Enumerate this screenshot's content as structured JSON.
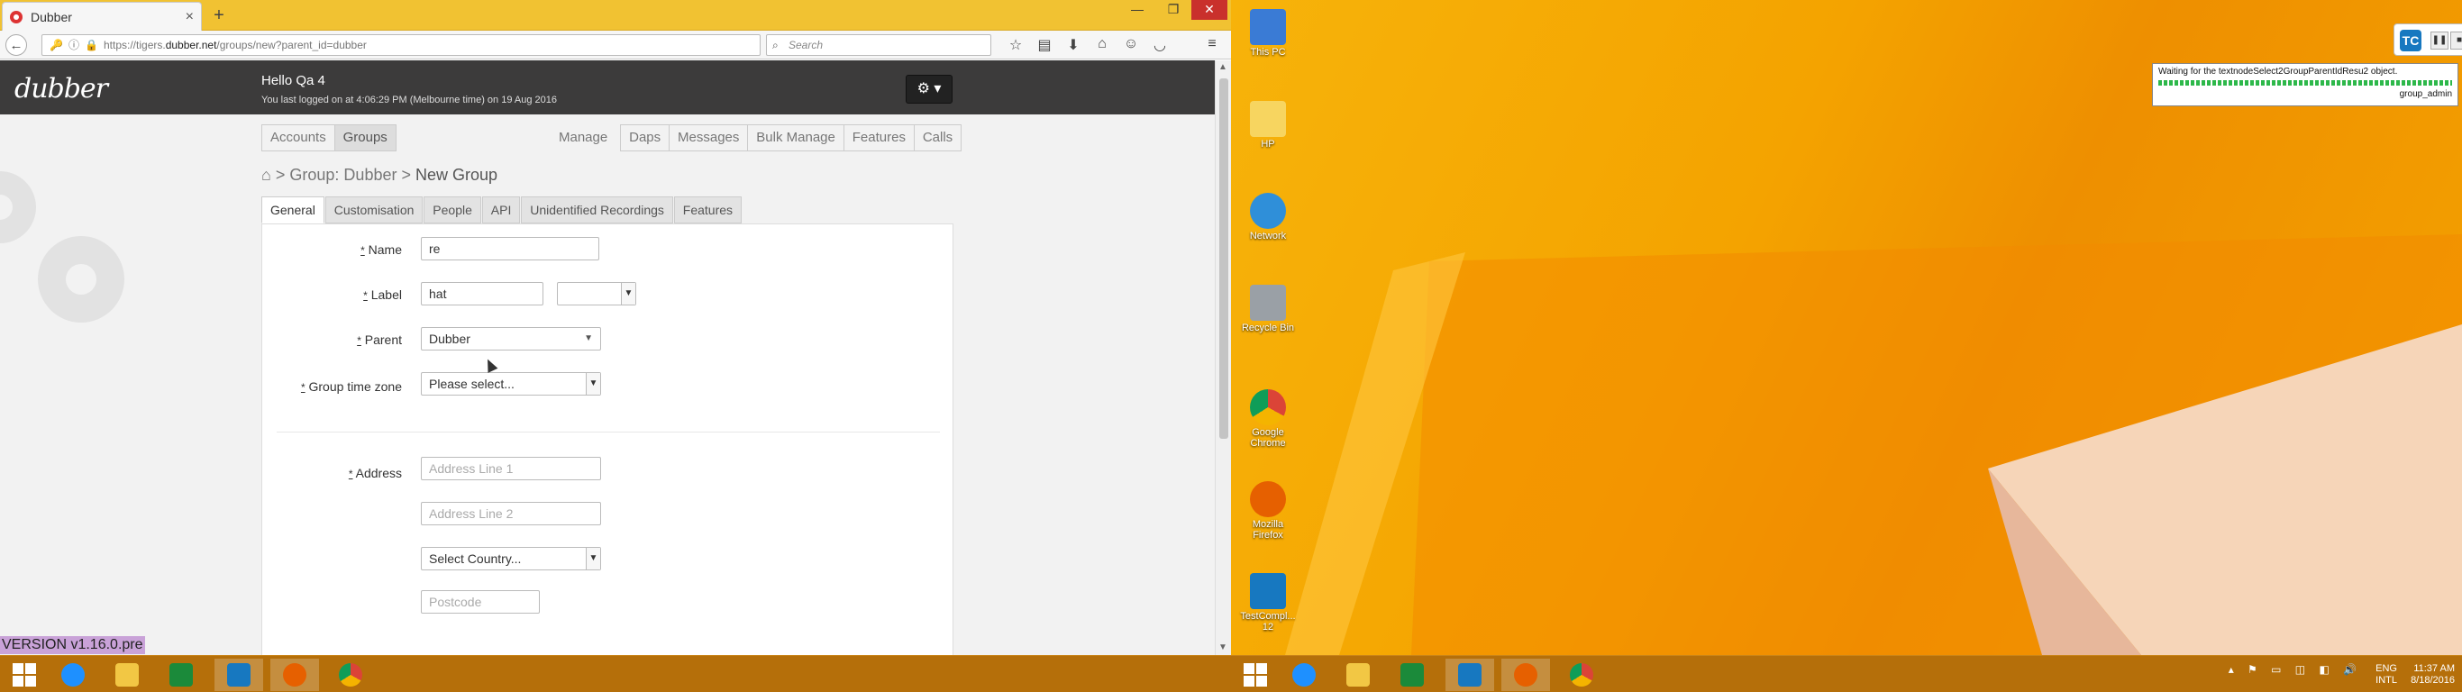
{
  "browser": {
    "tab_title": "Dubber",
    "tab_close": "×",
    "new_tab": "+",
    "url_prefix": "https://tigers.",
    "url_domain": "dubber.net",
    "url_path": "/groups/new?parent_id=dubber",
    "search_placeholder": "Search",
    "window_controls": {
      "minimize": "—",
      "restore": "❐",
      "close": "✕"
    }
  },
  "app": {
    "logo": "dubber",
    "greeting": "Hello Qa 4",
    "last_logon": "You last logged on at 4:06:29 PM (Melbourne time) on 19 Aug 2016",
    "settings_icon": "⚙ ▾",
    "primary_nav": [
      {
        "label": "Accounts",
        "active": false
      },
      {
        "label": "Groups",
        "active": true
      }
    ],
    "manage_label": "Manage",
    "manage_nav": [
      "Daps",
      "Messages",
      "Bulk Manage",
      "Features",
      "Calls"
    ],
    "breadcrumb": {
      "prefix": "> Group: Dubber >",
      "current": "New Group"
    },
    "form_tabs": [
      {
        "label": "General",
        "active": true
      },
      {
        "label": "Customisation",
        "active": false
      },
      {
        "label": "People",
        "active": false
      },
      {
        "label": "API",
        "active": false
      },
      {
        "label": "Unidentified Recordings",
        "active": false
      },
      {
        "label": "Features",
        "active": false
      }
    ],
    "form": {
      "required_mark": "*",
      "name_label": "Name",
      "name_value": "re",
      "label_label": "Label",
      "label_value": "hat",
      "label_select_value": "",
      "parent_label": "Parent",
      "parent_value": "Dubber",
      "timezone_label": "Group time zone",
      "timezone_value": "Please select...",
      "address_label": "Address",
      "address1_placeholder": "Address Line 1",
      "address2_placeholder": "Address Line 2",
      "country_value": "Select Country...",
      "postcode_placeholder": "Postcode"
    },
    "version": "VERSION v1.16.0.pre"
  },
  "desktop": {
    "icons": [
      {
        "name": "This PC",
        "color": "#3a7bd5"
      },
      {
        "name": "HP",
        "color": "#f7d560"
      },
      {
        "name": "Network",
        "color": "#2f8fd9"
      },
      {
        "name": "Recycle Bin",
        "color": "#9aa0a6"
      },
      {
        "name": "Google Chrome",
        "color": "#db4437"
      },
      {
        "name": "Mozilla Firefox",
        "color": "#e66000"
      },
      {
        "name": "TestCompl... 12",
        "color": "#1778c0"
      }
    ],
    "testcomplete": {
      "status": "Waiting for the textnodeSelect2GroupParentIdResu2 object.",
      "user": "group_admin",
      "pause": "❚❚",
      "stop": "■"
    }
  },
  "taskbar": {
    "apps": [
      {
        "name": "internet-explorer",
        "color": "#1e90ff",
        "active": false
      },
      {
        "name": "file-explorer",
        "color": "#f2c744",
        "active": false
      },
      {
        "name": "store",
        "color": "#1b8a3a",
        "active": false
      },
      {
        "name": "testcomplete",
        "color": "#1778c0",
        "active": true
      },
      {
        "name": "firefox",
        "color": "#e66000",
        "active": true
      },
      {
        "name": "chrome",
        "color": "#db4437",
        "active": false
      }
    ],
    "tray_icons": "▴ ⚑ ▭ ◫ ◧ 🔊",
    "lang_line1": "ENG",
    "lang_line2": "INTL",
    "time": "11:37 AM",
    "date": "8/18/2016"
  },
  "colors": {
    "accent_header": "#3c3b3b",
    "taskbar": "#b56f0a",
    "desktop": "#f4a300",
    "version_badge": "#c9a2d8"
  }
}
